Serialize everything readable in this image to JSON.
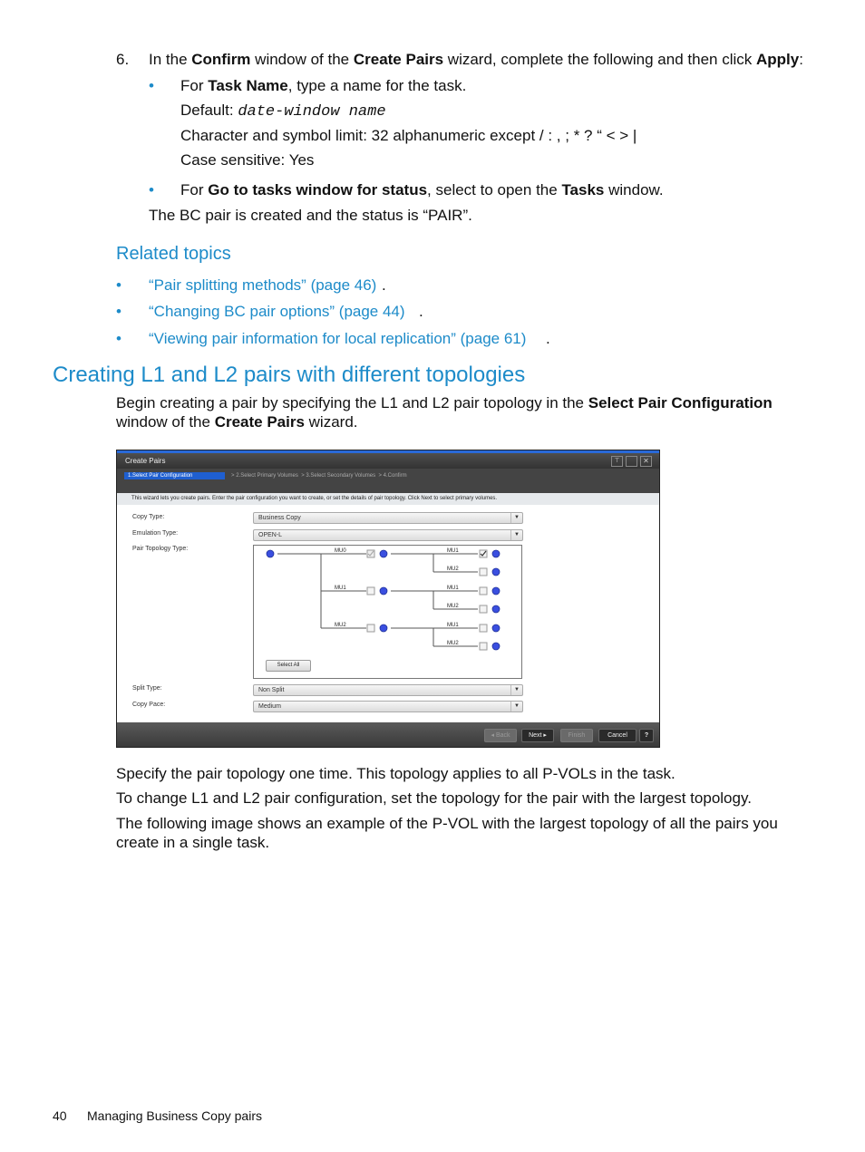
{
  "step6": {
    "num": "6.",
    "t1": "In the ",
    "b1": "Confirm",
    "t2": " window of the ",
    "b2": "Create Pairs",
    "t3": " wizard, complete the following and then click ",
    "b3": "Apply",
    "t4": ":"
  },
  "bullet1": {
    "t1": "For ",
    "b1": "Task Name",
    "t2": ", type a name for the task.",
    "default_label": "Default: ",
    "default_value": "date-window name",
    "limit": "Character and symbol limit: 32 alphanumeric except / : , ; * ? “ < > |",
    "case": "Case sensitive: Yes"
  },
  "bullet2": {
    "t1": "For ",
    "b1": "Go to tasks window for status",
    "t2": ", select to open the ",
    "b2": "Tasks",
    "t3": " window."
  },
  "result": "The BC pair is created and the status is “PAIR”.",
  "related": {
    "title": "Related topics",
    "links": [
      "“Pair splitting methods” (page 46)",
      "“Changing BC pair options” (page 44)",
      "“Viewing pair information for local replication” (page 61)"
    ]
  },
  "section": {
    "title": "Creating L1 and L2 pairs with different topologies",
    "p1a": "Begin creating a pair by specifying the L1 and L2 pair topology in the ",
    "p1b": "Select Pair Configuration",
    "p1c": "window of the ",
    "p1d": "Create Pairs",
    "p1e": " wizard."
  },
  "dialog": {
    "title": "Create Pairs",
    "steps": [
      "1.Select Pair Configuration",
      "2.Select Primary Volumes",
      "3.Select Secondary Volumes",
      "4.Confirm"
    ],
    "sep": ">",
    "info": "This wizard lets you create pairs. Enter the pair configuration you want to create, or set the details of pair topology. Click Next to select primary volumes.",
    "copy_type_label": "Copy Type:",
    "copy_type": "Business Copy",
    "emulation_label": "Emulation Type:",
    "emulation": "OPEN-L",
    "topology_label": "Pair Topology Type:",
    "l1": [
      "MU0",
      "MU1",
      "MU2"
    ],
    "l2": [
      "MU1",
      "MU2"
    ],
    "l1_checked": [
      true,
      false,
      false
    ],
    "l2_checked": [
      true,
      false,
      false,
      false,
      false,
      false
    ],
    "select_all": "Select All",
    "split_label": "Split Type:",
    "split": "Non Split",
    "pace_label": "Copy Pace:",
    "pace": "Medium",
    "buttons": {
      "back": "Back",
      "next": "Next",
      "finish": "Finish",
      "cancel": "Cancel",
      "help": "?"
    },
    "accent": "#1f5fd0"
  },
  "after": [
    "Specify the pair topology one time. This topology applies to all P-VOLs in the task.",
    "To change L1 and L2 pair configuration, set the topology for the pair with the largest topology.",
    "The following image shows an example of the P-VOL with the largest topology of all the pairs you",
    "create in a single task."
  ],
  "footer": {
    "page": "40",
    "title": "Managing Business Copy pairs"
  }
}
